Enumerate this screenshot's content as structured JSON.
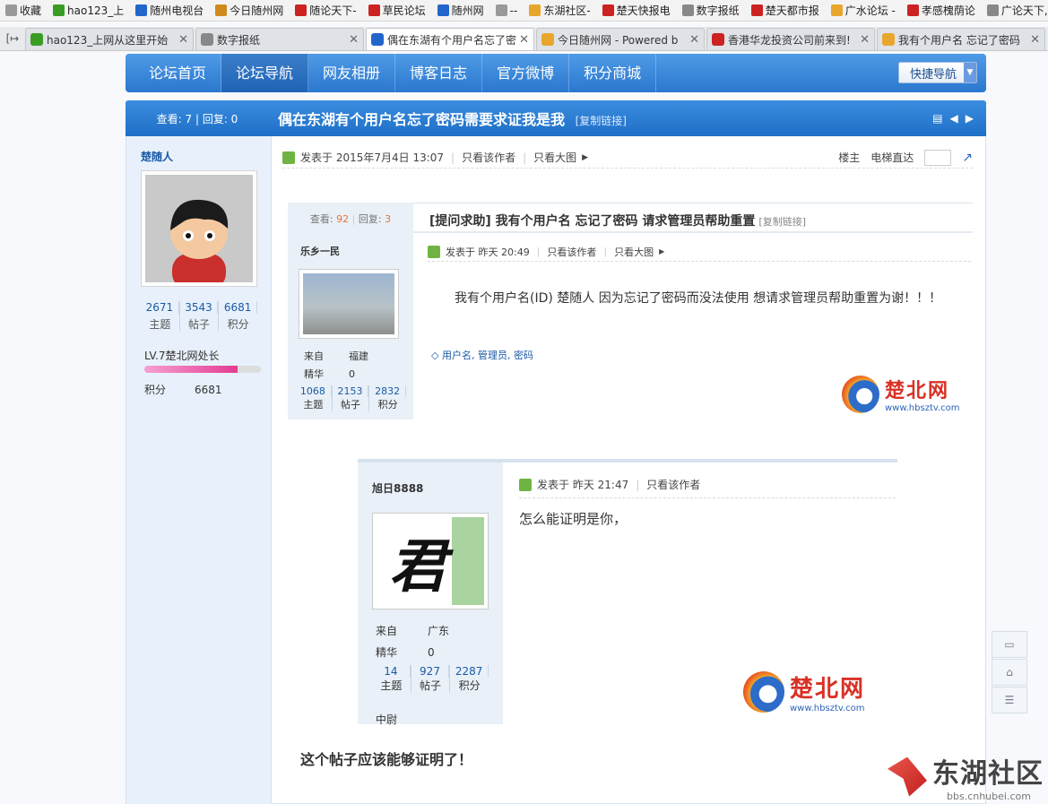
{
  "bookmarks": [
    {
      "label": "收藏",
      "color": "#999999"
    },
    {
      "label": "hao123_上",
      "color": "#3a9d23"
    },
    {
      "label": "随州电视台",
      "color": "#2266cc"
    },
    {
      "label": "今日随州网",
      "color": "#d08a1c"
    },
    {
      "label": "随论天下-",
      "color": "#cc2222"
    },
    {
      "label": "草民论坛",
      "color": "#cc2222"
    },
    {
      "label": "随州网",
      "color": "#2266cc"
    },
    {
      "label": "--",
      "color": "#999999"
    },
    {
      "label": "东湖社区-",
      "color": "#e8a72c"
    },
    {
      "label": "楚天快报电",
      "color": "#cc2222"
    },
    {
      "label": "数字报纸",
      "color": "#888888"
    },
    {
      "label": "楚天都市报",
      "color": "#cc2222"
    },
    {
      "label": "广水论坛 -",
      "color": "#e8a72c"
    },
    {
      "label": "孝感槐荫论",
      "color": "#cc2222"
    },
    {
      "label": "广论天下,",
      "color": "#888888"
    }
  ],
  "tabs": [
    {
      "label": "hao123_上网从这里开始",
      "color": "#3a9d23",
      "active": false
    },
    {
      "label": "数字报纸",
      "color": "#888888",
      "active": false
    },
    {
      "label": "偶在东湖有个用户名忘了密",
      "color": "#2266cc",
      "active": true
    },
    {
      "label": "今日随州网 - Powered b",
      "color": "#e8a72c",
      "active": false
    },
    {
      "label": "香港华龙投资公司前来到!",
      "color": "#cc2222",
      "active": false
    },
    {
      "label": "我有个用户名 忘记了密码",
      "color": "#e8a72c",
      "active": false
    }
  ],
  "nav": {
    "items": [
      "论坛首页",
      "论坛导航",
      "网友相册",
      "博客日志",
      "官方微博",
      "积分商城"
    ],
    "quick": "快捷导航"
  },
  "thread": {
    "stats": "查看: 7 | 回复: 0",
    "title": "偶在东湖有个用户名忘了密码需要求证我是我",
    "copy_link": "[复制链接]"
  },
  "author": {
    "name": "楚随人",
    "topics": "2671",
    "posts": "3543",
    "points": "6681",
    "topics_label": "主题",
    "posts_label": "帖子",
    "points_label": "积分",
    "level": "LV.7楚北网处长",
    "points_row_label": "积分",
    "points_row_value": "6681"
  },
  "post_header": {
    "posted": "发表于 2015年7月4日 13:07",
    "only_author": "只看该作者",
    "big_image": "只看大图",
    "floor": "楼主",
    "elevator": "电梯直达"
  },
  "embedded_post": {
    "views_label": "查看:",
    "views": "92",
    "replies_label": "回复:",
    "replies": "3",
    "title": "[提问求助] 我有个用户名 忘记了密码 请求管理员帮助重置",
    "copy_link": "[复制链接]",
    "user": "乐乡一民",
    "from_label": "来自",
    "from": "福建",
    "essence_label": "精华",
    "essence": "0",
    "topics": "1068",
    "posts": "2153",
    "points": "2832",
    "topics_label": "主题",
    "posts_label": "帖子",
    "points_label": "积分",
    "posted": "发表于 昨天 20:49",
    "only_author": "只看该作者",
    "big_image": "只看大图",
    "body": "我有个用户名(ID)   楚随人   因为忘记了密码而没法使用  想请求管理员帮助重置为谢！！！",
    "tags": "用户名, 管理员, 密码"
  },
  "logo": {
    "name": "楚北网",
    "url": "www.hbsztv.com"
  },
  "embedded_reply": {
    "user": "旭日8888",
    "avatar_char": "君",
    "from_label": "来自",
    "from": "广东",
    "essence_label": "精华",
    "essence": "0",
    "topics": "14",
    "posts": "927",
    "points": "2287",
    "topics_label": "主题",
    "posts_label": "帖子",
    "points_label": "积分",
    "rank": "中尉",
    "posted": "发表于 昨天 21:47",
    "only_author": "只看该作者",
    "body": "怎么能证明是你，"
  },
  "closing_text": "这个帖子应该能够证明了！",
  "watermark": {
    "name": "东湖社区",
    "url": "bbs.cnhubei.com"
  }
}
